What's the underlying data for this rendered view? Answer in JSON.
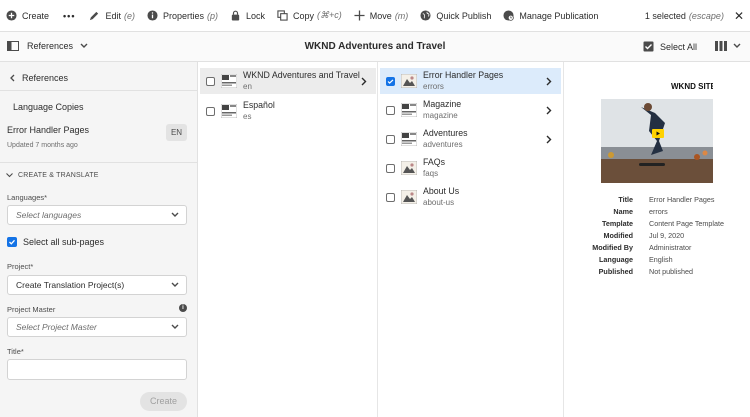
{
  "actionbar": {
    "create": "Create",
    "more": "•••",
    "edit": "Edit",
    "edit_sc": "(e)",
    "properties": "Properties",
    "properties_sc": "(p)",
    "lock": "Lock",
    "copy": "Copy",
    "copy_sc": "(⌘+c)",
    "move": "Move",
    "move_sc": "(m)",
    "quick_publish": "Quick Publish",
    "manage_publication": "Manage Publication",
    "selection_count": "1 selected",
    "escape_hint": "(escape)",
    "close": "✕"
  },
  "toolbar": {
    "rail_label": "References",
    "title": "WKND Adventures and Travel",
    "select_all": "Select All"
  },
  "rail": {
    "back_label": "References",
    "language_copies": "Language Copies",
    "ref_name": "Error Handler Pages",
    "ref_updated": "Updated 7 months ago",
    "ref_lang": "EN",
    "section_title": "CREATE & TRANSLATE",
    "languages_label": "Languages*",
    "languages_placeholder": "Select languages",
    "select_subpages": "Select all sub-pages",
    "project_label": "Project*",
    "project_value": "Create Translation Project(s)",
    "project_master_label": "Project Master",
    "project_master_placeholder": "Select Project Master",
    "title_label": "Title*",
    "title_value": "",
    "create_button": "Create"
  },
  "columns": [
    {
      "items": [
        {
          "title": "WKND Adventures and Travel",
          "name": "en",
          "has_children": true,
          "state": "active",
          "checked": false
        },
        {
          "title": "Español",
          "name": "es",
          "has_children": false,
          "state": "none",
          "checked": false
        }
      ]
    },
    {
      "items": [
        {
          "title": "Error Handler Pages",
          "name": "errors",
          "has_children": true,
          "state": "selected",
          "checked": true
        },
        {
          "title": "Magazine",
          "name": "magazine",
          "has_children": true,
          "state": "none",
          "checked": false
        },
        {
          "title": "Adventures",
          "name": "adventures",
          "has_children": true,
          "state": "none",
          "checked": false
        },
        {
          "title": "FAQs",
          "name": "faqs",
          "has_children": false,
          "state": "none",
          "checked": false
        },
        {
          "title": "About Us",
          "name": "about-us",
          "has_children": false,
          "state": "none",
          "checked": false
        }
      ]
    }
  ],
  "preview": {
    "image_brand": "WKND SITE",
    "meta": [
      {
        "key": "Title",
        "value": "Error Handler Pages"
      },
      {
        "key": "Name",
        "value": "errors"
      },
      {
        "key": "Template",
        "value": "Content Page Template"
      },
      {
        "key": "Modified",
        "value": "Jul 9, 2020"
      },
      {
        "key": "Modified By",
        "value": "Administrator"
      },
      {
        "key": "Language",
        "value": "English"
      },
      {
        "key": "Published",
        "value": "Not published"
      }
    ]
  },
  "colors": {
    "accent": "#1473e6",
    "selected_row": "#dcebfb",
    "play_button": "#ffd200"
  }
}
